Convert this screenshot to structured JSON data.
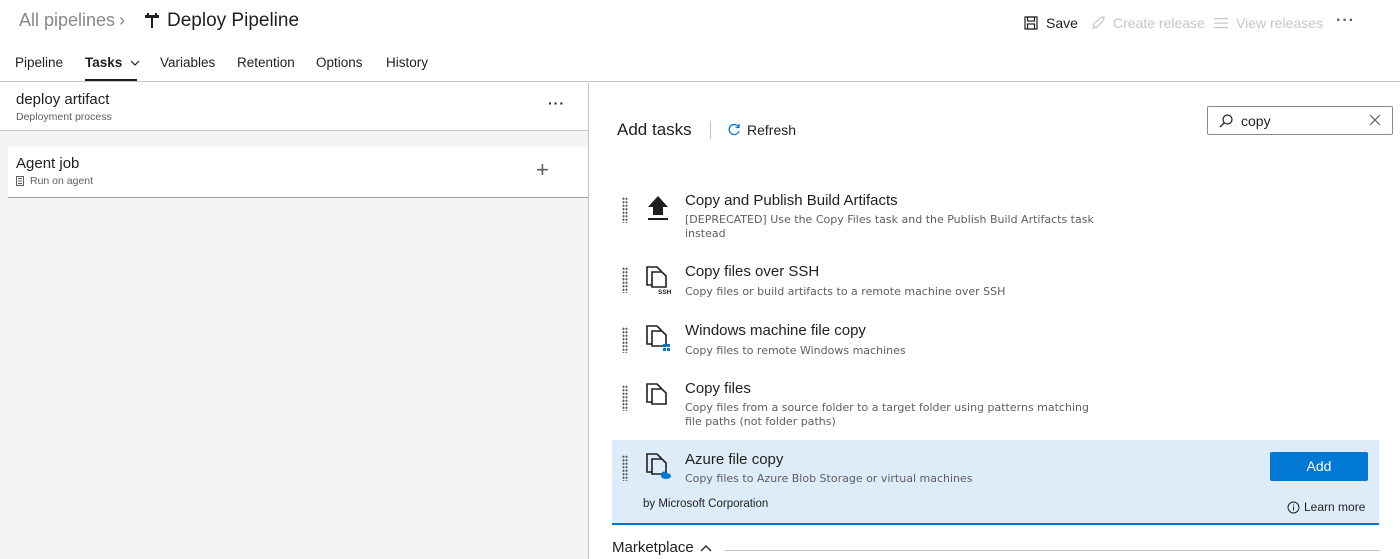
{
  "header": {
    "breadcrumb": "All pipelines",
    "title": "Deploy Pipeline",
    "save_label": "Save",
    "create_release_label": "Create release",
    "view_releases_label": "View releases",
    "more": "···"
  },
  "tabs": [
    {
      "label": "Pipeline"
    },
    {
      "label": "Tasks",
      "active": true
    },
    {
      "label": "Variables"
    },
    {
      "label": "Retention"
    },
    {
      "label": "Options"
    },
    {
      "label": "History"
    }
  ],
  "stage": {
    "name": "deploy artifact",
    "subtitle": "Deployment process",
    "more": "···"
  },
  "job": {
    "name": "Agent job",
    "subtitle": "Run on agent",
    "add": "+"
  },
  "add_tasks": {
    "title": "Add tasks",
    "refresh_label": "Refresh",
    "search_value": "copy"
  },
  "tasks": [
    {
      "name": "Copy and Publish Build Artifacts",
      "description": "[DEPRECATED] Use the Copy Files task and the Publish Build Artifacts task instead",
      "icon": "upload-artifact-icon"
    },
    {
      "name": "Copy files over SSH",
      "description": "Copy files or build artifacts to a remote machine over SSH",
      "icon": "copy-ssh-icon"
    },
    {
      "name": "Windows machine file copy",
      "description": "Copy files to remote Windows machines",
      "icon": "windows-copy-icon"
    },
    {
      "name": "Copy files",
      "description": "Copy files from a source folder to a target folder using patterns matching file paths (not folder paths)",
      "icon": "copy-files-icon"
    },
    {
      "name": "Azure file copy",
      "description": "Copy files to Azure Blob Storage or virtual machines",
      "icon": "azure-copy-icon",
      "selected": true,
      "publisher": "by Microsoft Corporation",
      "add_label": "Add",
      "learn_more_label": "Learn more"
    }
  ],
  "marketplace": {
    "label": "Marketplace"
  },
  "colors": {
    "accent": "#0078d4",
    "selected_bg": "#deecf9"
  }
}
